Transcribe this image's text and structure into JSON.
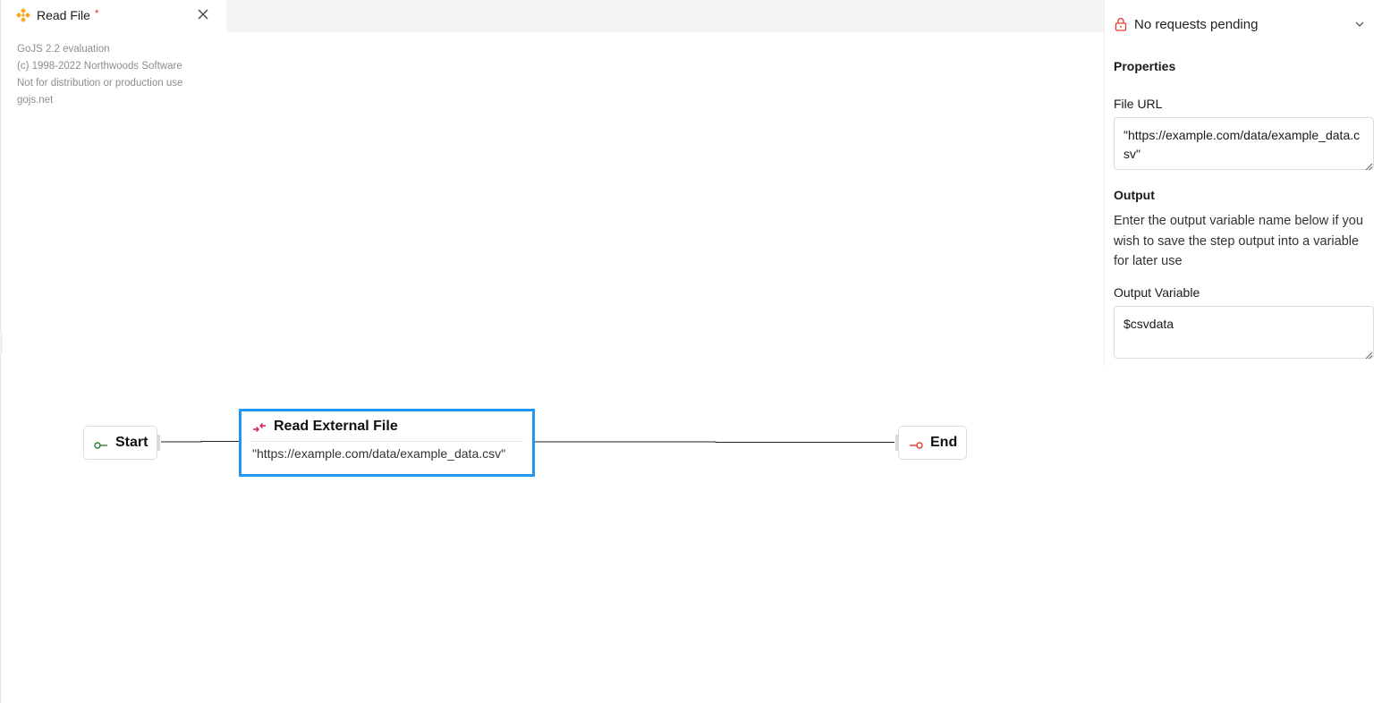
{
  "tab": {
    "title": "Read File",
    "modified_marker": "*",
    "icon": "workflow-icon",
    "close_icon": "close-icon"
  },
  "watermark": {
    "line1": "GoJS 2.2 evaluation",
    "line2": "(c) 1998-2022 Northwoods Software",
    "line3": "Not for distribution or production use",
    "line4": "gojs.net"
  },
  "panel": {
    "requests_status": "No requests pending",
    "properties_heading": "Properties",
    "file_url_label": "File URL",
    "file_url_value": "\"https://example.com/data/example_data.csv\"",
    "output_heading": "Output",
    "output_description": "Enter the output variable name below if you wish to save the step output into a variable for later use",
    "output_variable_label": "Output Variable",
    "output_variable_value": "$csvdata"
  },
  "diagram": {
    "start_label": "Start",
    "end_label": "End",
    "step_title": "Read External File",
    "step_detail": "\"https://example.com/data/example_data.csv\""
  },
  "colors": {
    "selection_border": "#2196f3",
    "start_icon": "#2e7d32",
    "end_icon": "#e53935",
    "step_icon": "#d81b60",
    "tab_icon": "#f5a623",
    "modified_marker": "#e53935"
  }
}
